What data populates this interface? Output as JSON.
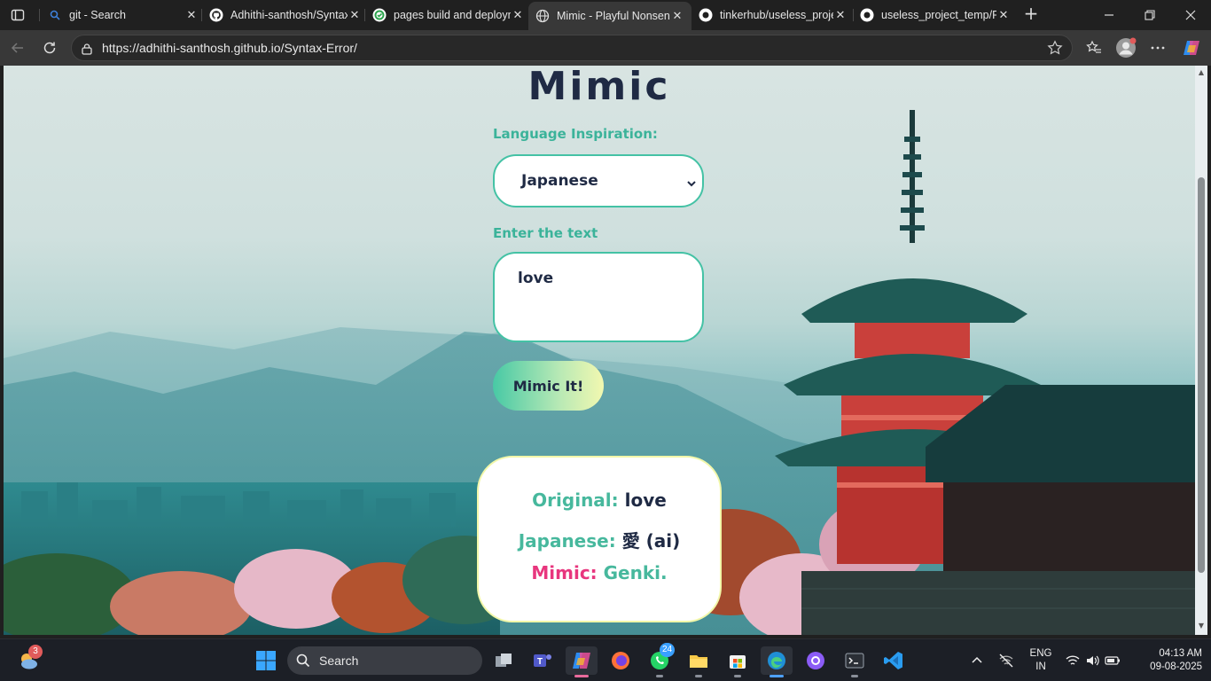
{
  "browser": {
    "tabs": [
      {
        "title": "git - Search",
        "icon": "search-icon"
      },
      {
        "title": "Adhithi-santhosh/Syntax-Error",
        "icon": "github-icon"
      },
      {
        "title": "pages build and deployment",
        "icon": "github-actions-icon"
      },
      {
        "title": "Mimic - Playful Nonsense",
        "icon": "globe-icon",
        "active": true
      },
      {
        "title": "tinkerhub/useless_project",
        "icon": "github-icon"
      },
      {
        "title": "useless_project_temp/README",
        "icon": "github-icon"
      }
    ],
    "address": "https://adhithi-santhosh.github.io/Syntax-Error/"
  },
  "page": {
    "title": "Mimic",
    "language_label": "Language Inspiration:",
    "language_selected": "Japanese",
    "text_label": "Enter the text",
    "text_value": "love",
    "button_label": "Mimic It!",
    "result": {
      "original_key": "Original:",
      "original_value": "love",
      "language_key": "Japanese:",
      "language_value": "愛 (ai)",
      "mimic_key": "Mimic:",
      "mimic_value": "Genki."
    }
  },
  "taskbar": {
    "search_label": "Search",
    "weather_badge": "3",
    "whatsapp_badge": "24",
    "lang_line1": "ENG",
    "lang_line2": "IN",
    "time": "04:13 AM",
    "date": "09-08-2025"
  },
  "colors": {
    "accent_teal": "#47b89d",
    "accent_pink": "#e8367e",
    "title_dark": "#1f2a44"
  }
}
